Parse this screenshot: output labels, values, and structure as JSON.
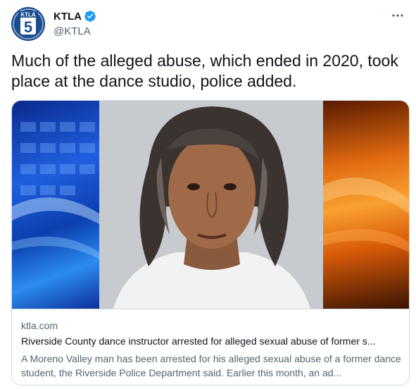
{
  "author": {
    "name": "KTLA",
    "handle": "@KTLA",
    "logo_text": "KTLA",
    "logo_number": "5",
    "verified": true,
    "avatar_color": "#1b4d8f"
  },
  "tweet": {
    "text": "Much of the alleged abuse, which ended in 2020, took place at the dance studio, police added."
  },
  "more_icon": "more-horizontal-icon",
  "card": {
    "domain": "ktla.com",
    "title": "Riverside County dance instructor arrested for alleged sexual abuse of former s...",
    "description": "A Moreno Valley man has been arrested for his alleged sexual abuse of a former dance student, the Riverside Police Department said. Earlier this month, an ad..."
  },
  "colors": {
    "verified_blue": "#1d9bf0",
    "text_primary": "#0f1419",
    "text_secondary": "#536471",
    "border": "#cfd9de"
  }
}
